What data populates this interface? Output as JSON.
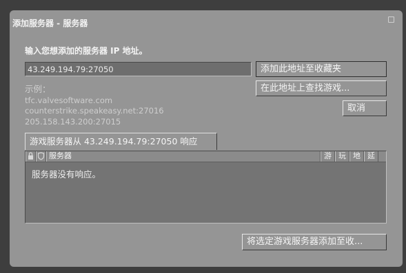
{
  "window": {
    "title": "添加服务器 - 服务器"
  },
  "prompt": "输入您想添加的服务器 IP 地址。",
  "address_input": {
    "value": "43.249.194.79:27050"
  },
  "buttons": {
    "add_to_favorites": "添加此地址至收藏夹",
    "find_games": "在此地址上查找游戏...",
    "cancel": "取消",
    "add_selected": "将选定游戏服务器添加至收..."
  },
  "examples": {
    "heading": "示例：",
    "items": [
      "tfc.valvesoftware.com",
      "counterstrike.speakeasy.net:27016",
      "205.158.143.200:27015"
    ]
  },
  "response_tab": {
    "label": "游戏服务器从 43.249.194.79:27050  响应"
  },
  "server_list": {
    "columns": {
      "lock": "lock-icon",
      "secure": "shield-icon",
      "servers": "服务器",
      "game": "游",
      "players": "玩",
      "map": "地",
      "latency": "延"
    },
    "empty_message": "服务器没有响应。"
  }
}
